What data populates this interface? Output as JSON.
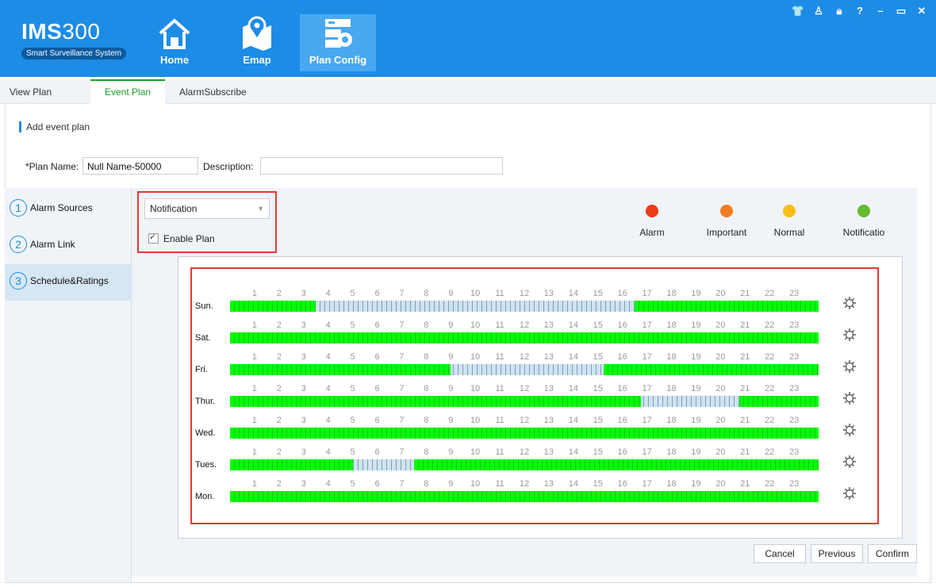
{
  "app": {
    "logo": {
      "brand": "IMS",
      "number": "300",
      "tagline": "Smart Surveillance System"
    },
    "nav": [
      {
        "label": "Home",
        "icon": "home-icon"
      },
      {
        "label": "Emap",
        "icon": "map-icon"
      },
      {
        "label": "Plan Config",
        "icon": "plan-config-icon"
      }
    ],
    "window_controls": [
      "shirt-icon",
      "user-icon",
      "lock-icon",
      "help-icon",
      "minimize-icon",
      "maximize-icon",
      "close-icon"
    ]
  },
  "tabs": [
    {
      "label": "View Plan",
      "active": false
    },
    {
      "label": "Event Plan",
      "active": true
    },
    {
      "label": "AlarmSubscribe",
      "active": false
    }
  ],
  "form": {
    "section_title": "Add event plan",
    "plan_name_label": "*Plan Name:",
    "plan_name_value": "Null Name-50000",
    "description_label": "Description:",
    "description_value": ""
  },
  "steps": [
    {
      "num": "1",
      "label": "Alarm Sources"
    },
    {
      "num": "2",
      "label": "Alarm Link"
    },
    {
      "num": "3",
      "label": "Schedule&Ratings",
      "active": true
    }
  ],
  "config": {
    "level_select": "Notification",
    "enable_plan_label": "Enable Plan",
    "enable_plan_checked": true
  },
  "legend": [
    {
      "label": "Alarm",
      "color": "#f03c14"
    },
    {
      "label": "Important",
      "color": "#f47c20"
    },
    {
      "label": "Normal",
      "color": "#fbbd18"
    },
    {
      "label": "Notificatio",
      "color": "#66bb2e"
    }
  ],
  "schedule": {
    "hour_labels": [
      "1",
      "2",
      "3",
      "4",
      "5",
      "6",
      "7",
      "8",
      "9",
      "10",
      "11",
      "12",
      "13",
      "14",
      "15",
      "16",
      "17",
      "18",
      "19",
      "20",
      "21",
      "22",
      "23"
    ],
    "active_color": "#00ff00",
    "inactive_color": "#cfe3f1",
    "days": [
      {
        "label": "Sun.",
        "active_hours": [
          [
            0,
            3.5
          ],
          [
            16.5,
            24
          ]
        ]
      },
      {
        "label": "Sat.",
        "active_hours": [
          [
            0,
            24
          ]
        ]
      },
      {
        "label": "Fri.",
        "active_hours": [
          [
            0,
            9
          ],
          [
            15.25,
            24
          ]
        ]
      },
      {
        "label": "Thur.",
        "active_hours": [
          [
            0,
            16.75
          ],
          [
            20.75,
            24
          ]
        ]
      },
      {
        "label": "Wed.",
        "active_hours": [
          [
            0,
            24
          ]
        ]
      },
      {
        "label": "Tues.",
        "active_hours": [
          [
            0,
            5
          ],
          [
            7.5,
            24
          ]
        ]
      },
      {
        "label": "Mon.",
        "active_hours": [
          [
            0,
            24
          ]
        ]
      }
    ]
  },
  "buttons": {
    "cancel": "Cancel",
    "previous": "Previous",
    "confirm": "Confirm"
  }
}
